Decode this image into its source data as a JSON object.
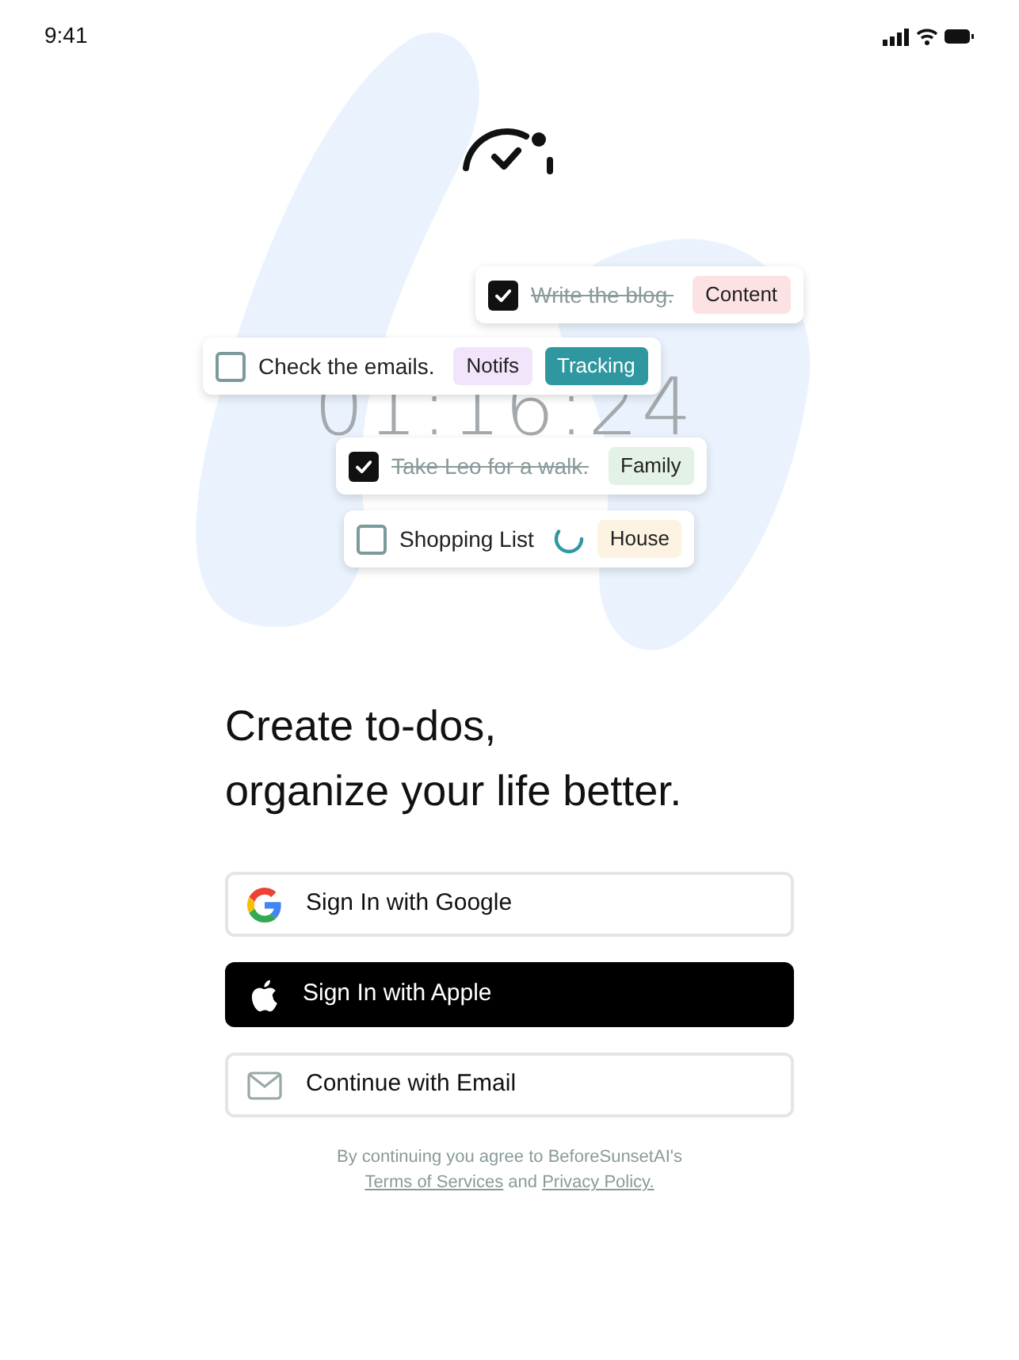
{
  "status_bar": {
    "time": "9:41"
  },
  "timer": "01:16:24",
  "tasks": [
    {
      "title": "Write the blog.",
      "checked": true,
      "in_progress": false,
      "tags": [
        {
          "label": "Content",
          "color": "#fde2e4",
          "filled": false
        }
      ]
    },
    {
      "title": "Check the emails.",
      "checked": false,
      "in_progress": false,
      "tags": [
        {
          "label": "Notifs",
          "color": "#f1e4fb",
          "filled": false
        },
        {
          "label": "Tracking",
          "color": "#2f97a0",
          "filled": true
        }
      ]
    },
    {
      "title": "Take Leo for a walk.",
      "checked": true,
      "in_progress": false,
      "tags": [
        {
          "label": "Family",
          "color": "#e3f1e6",
          "filled": false
        }
      ]
    },
    {
      "title": "Shopping List",
      "checked": false,
      "in_progress": true,
      "tags": [
        {
          "label": "House",
          "color": "#fdf3e2",
          "filled": false
        }
      ]
    }
  ],
  "headline": [
    "Create to-dos,",
    "organize your life better."
  ],
  "buttons": [
    {
      "kind": "google",
      "label": "Sign In with Google"
    },
    {
      "kind": "apple",
      "label": "Sign In with Apple"
    },
    {
      "kind": "email",
      "label": "Continue with Email"
    }
  ],
  "legal": {
    "text": "By continuing you agree to BeforeSunsetAI's",
    "terms": "Terms of Services",
    "and": "and",
    "privacy": "Privacy Policy."
  }
}
